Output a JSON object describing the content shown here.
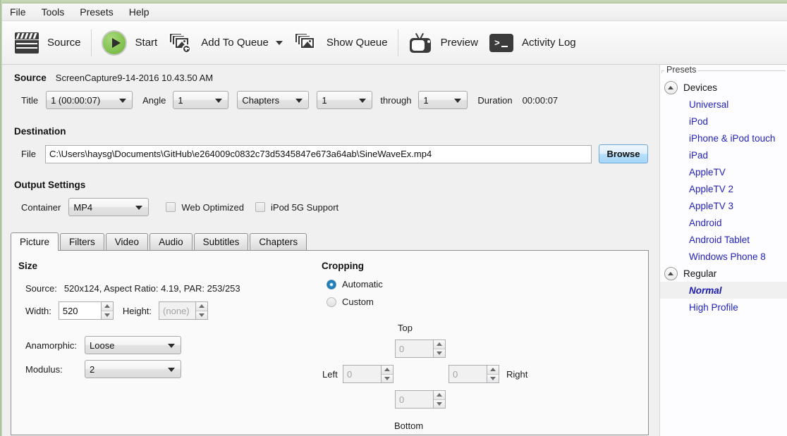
{
  "window": {
    "app": "HandBrake"
  },
  "menubar": {
    "items": [
      {
        "label": "File"
      },
      {
        "label": "Tools"
      },
      {
        "label": "Presets"
      },
      {
        "label": "Help"
      }
    ]
  },
  "toolbar": {
    "buttons": [
      {
        "label": "Source",
        "icon": "clapperboard-icon",
        "has_caret": false
      },
      {
        "label": "Start",
        "icon": "play-icon",
        "has_caret": false
      },
      {
        "label": "Add To Queue",
        "icon": "add-to-queue-icon",
        "has_caret": true
      },
      {
        "label": "Show Queue",
        "icon": "queue-stack-icon",
        "has_caret": false
      },
      {
        "label": "Preview",
        "icon": "television-icon",
        "has_caret": false
      },
      {
        "label": "Activity Log",
        "icon": "console-icon",
        "has_caret": false
      }
    ]
  },
  "source": {
    "heading": "Source",
    "name": "ScreenCapture9-14-2016 10.43.50 AM",
    "title_label": "Title",
    "title_value": "1 (00:00:07)",
    "angle_label": "Angle",
    "angle_value": "1",
    "range_type_value": "Chapters",
    "chapter_start_value": "1",
    "through_label": "through",
    "chapter_end_value": "1",
    "duration_label": "Duration",
    "duration_value": "00:00:07"
  },
  "destination": {
    "heading": "Destination",
    "file_label": "File",
    "file_value": "C:\\Users\\haysg\\Documents\\GitHub\\e264009c0832c73d5345847e673a64ab\\SineWaveEx.mp4",
    "browse_label": "Browse"
  },
  "output_settings": {
    "heading": "Output Settings",
    "container_label": "Container",
    "container_value": "MP4",
    "web_optimized_label": "Web Optimized",
    "web_optimized_checked": false,
    "ipod_5g_label": "iPod 5G Support",
    "ipod_5g_checked": false
  },
  "tabs": [
    {
      "label": "Picture",
      "active": true
    },
    {
      "label": "Filters",
      "active": false
    },
    {
      "label": "Video",
      "active": false
    },
    {
      "label": "Audio",
      "active": false
    },
    {
      "label": "Subtitles",
      "active": false
    },
    {
      "label": "Chapters",
      "active": false
    }
  ],
  "picture": {
    "size": {
      "heading": "Size",
      "source_label": "Source:",
      "source_value": "520x124, Aspect Ratio: 4.19, PAR: 253/253",
      "width_label": "Width:",
      "width_value": "520",
      "height_label": "Height:",
      "height_placeholder": "(none)",
      "anamorphic_label": "Anamorphic:",
      "anamorphic_value": "Loose",
      "modulus_label": "Modulus:",
      "modulus_value": "2"
    },
    "cropping": {
      "heading": "Cropping",
      "automatic_label": "Automatic",
      "custom_label": "Custom",
      "mode": "Automatic",
      "top_label": "Top",
      "top_value": "0",
      "left_label": "Left",
      "left_value": "0",
      "right_label": "Right",
      "right_value": "0",
      "bottom_label": "Bottom",
      "bottom_value": "0"
    }
  },
  "presets": {
    "legend": "Presets",
    "groups": [
      {
        "label": "Devices",
        "items": [
          {
            "label": "Universal",
            "selected": false
          },
          {
            "label": "iPod",
            "selected": false
          },
          {
            "label": "iPhone & iPod touch",
            "selected": false
          },
          {
            "label": "iPad",
            "selected": false
          },
          {
            "label": "AppleTV",
            "selected": false
          },
          {
            "label": "AppleTV 2",
            "selected": false
          },
          {
            "label": "AppleTV 3",
            "selected": false
          },
          {
            "label": "Android",
            "selected": false
          },
          {
            "label": "Android Tablet",
            "selected": false
          },
          {
            "label": "Windows Phone 8",
            "selected": false
          }
        ]
      },
      {
        "label": "Regular",
        "items": [
          {
            "label": "Normal",
            "selected": true
          },
          {
            "label": "High Profile",
            "selected": false
          }
        ]
      }
    ]
  },
  "colors": {
    "window_chrome": "#bfd0af",
    "preset_link": "#2222bb",
    "accent_button": "#a6d7f7",
    "radio_on": "#1c6fa8",
    "play_green": "#8cc85a"
  }
}
